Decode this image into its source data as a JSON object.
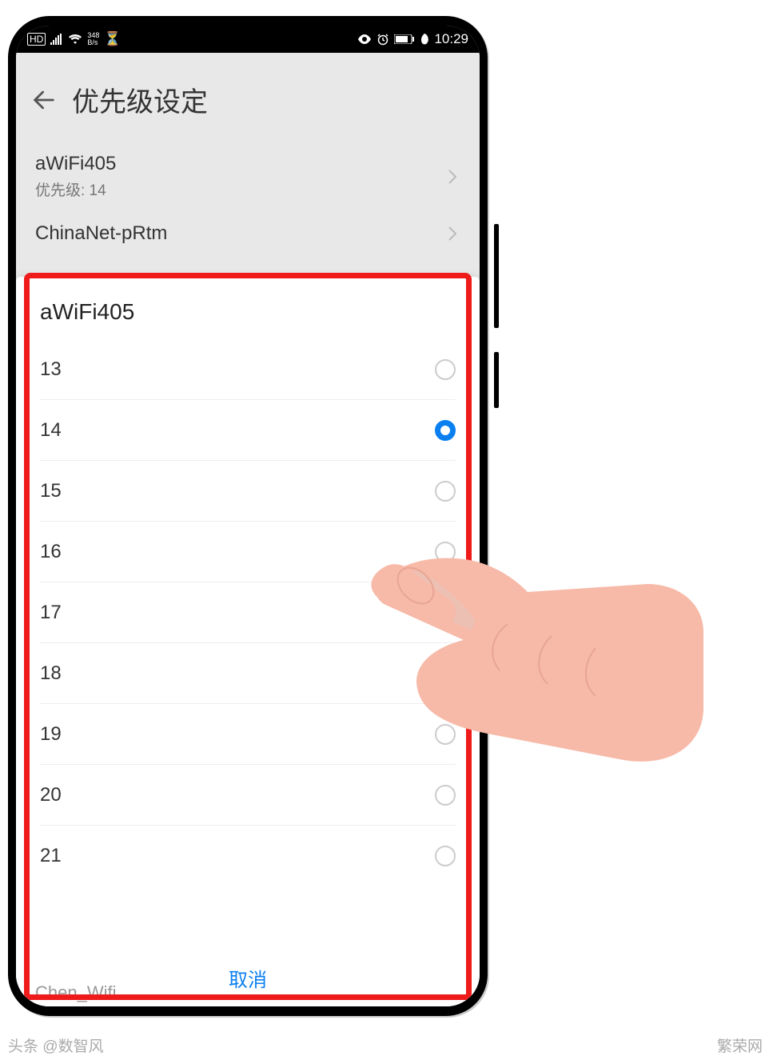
{
  "status": {
    "hd": "HD",
    "net_up": "348",
    "net_dn": "B/s",
    "time": "10:29"
  },
  "header": {
    "title": "优先级设定"
  },
  "wifi_list": [
    {
      "name": "aWiFi405",
      "subtitle": "优先级: 14"
    },
    {
      "name": "ChinaNet-pRtm",
      "subtitle": ""
    }
  ],
  "modal": {
    "title": "aWiFi405",
    "options": [
      {
        "label": "13",
        "selected": false
      },
      {
        "label": "14",
        "selected": true
      },
      {
        "label": "15",
        "selected": false
      },
      {
        "label": "16",
        "selected": false
      },
      {
        "label": "17",
        "selected": false
      },
      {
        "label": "18",
        "selected": false
      },
      {
        "label": "19",
        "selected": false
      },
      {
        "label": "20",
        "selected": false
      },
      {
        "label": "21",
        "selected": false
      }
    ],
    "cancel": "取消"
  },
  "peek": "Chen_Wifi",
  "watermark": {
    "left": "头条 @数智风",
    "right": "繁荣网"
  }
}
